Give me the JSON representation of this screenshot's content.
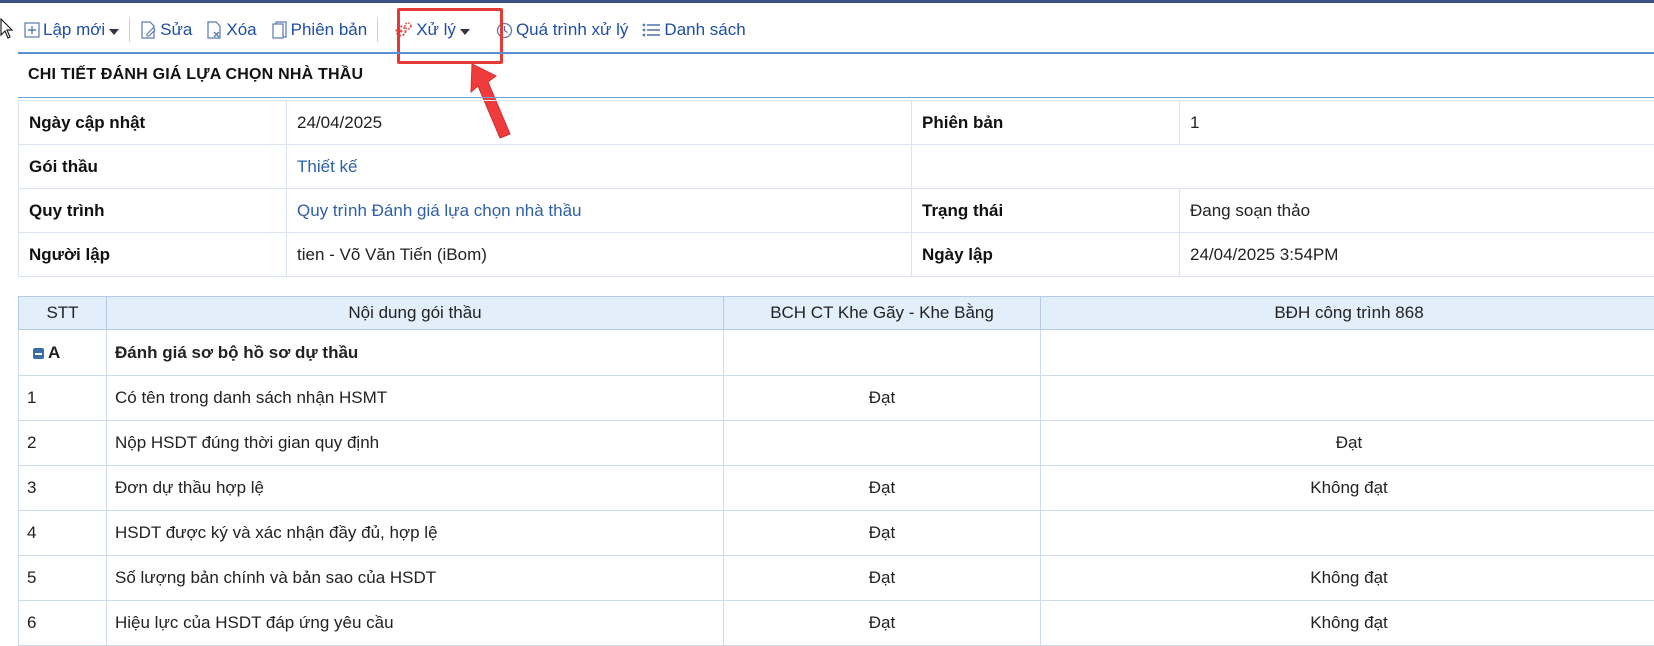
{
  "toolbar": {
    "new_label": "Lập mới",
    "edit_label": "Sửa",
    "delete_label": "Xóa",
    "version_label": "Phiên bản",
    "process_label": "Xử lý",
    "history_label": "Quá trình xử lý",
    "list_label": "Danh sách"
  },
  "section_title": "CHI TIẾT ĐÁNH GIÁ LỰA CHỌN NHÀ THẦU",
  "info": {
    "updated_date_label": "Ngày cập nhật",
    "updated_date": "24/04/2025",
    "version_label": "Phiên bản",
    "version": "1",
    "package_label": "Gói thầu",
    "package": "Thiết kế",
    "process_label": "Quy trình",
    "process": "Quy trình Đánh giá lựa chọn nhà thầu",
    "status_label": "Trạng thái",
    "status": "Đang soạn thảo",
    "creator_label": "Người lập",
    "creator": "tien - Võ Văn Tiến (iBom)",
    "created_date_label": "Ngày lập",
    "created_date": "24/04/2025 3:54PM"
  },
  "grid": {
    "headers": [
      "STT",
      "Nội dung gói thầu",
      "BCH CT Khe Gãy - Khe Bằng",
      "BĐH công trình 868"
    ],
    "group": {
      "code": "A",
      "title": "Đánh giá sơ bộ hồ sơ dự thầu"
    },
    "rows": [
      {
        "stt": "1",
        "content": "Có tên trong danh sách nhận HSMT",
        "col1": "Đạt",
        "col2": ""
      },
      {
        "stt": "2",
        "content": "Nộp HSDT đúng thời gian quy định",
        "col1": "",
        "col2": "Đạt"
      },
      {
        "stt": "3",
        "content": "Đơn dự thầu hợp lệ",
        "col1": "Đạt",
        "col2": "Không đạt"
      },
      {
        "stt": "4",
        "content": "HSDT được ký và xác nhận đầy đủ, hợp lệ",
        "col1": "Đạt",
        "col2": ""
      },
      {
        "stt": "5",
        "content": "Số lượng bản chính và bản sao của HSDT",
        "col1": "Đạt",
        "col2": "Không đạt"
      },
      {
        "stt": "6",
        "content": "Hiệu lực của HSDT đáp ứng yêu cầu",
        "col1": "Đạt",
        "col2": "Không đạt"
      }
    ]
  },
  "colors": {
    "link": "#1f4ea3",
    "highlight": "#e53935",
    "header_bg": "#e3eefb"
  }
}
